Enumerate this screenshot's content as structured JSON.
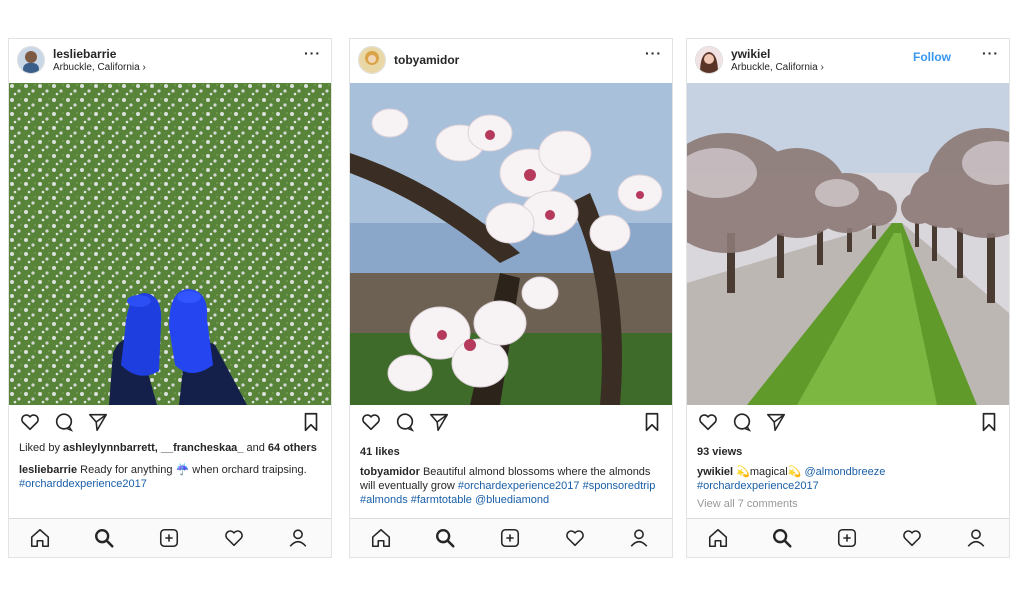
{
  "posts": [
    {
      "username": "lesliebarrie",
      "location": "Arbuckle, California ›",
      "more": "···",
      "likes_prefix": "Liked by",
      "likes_users": "ashleylynnbarrett, __francheskaa_",
      "likes_and": "and",
      "likes_count": "64 others",
      "caption_user": "lesliebarrie",
      "caption_text": "Ready for anything ☔ when orchard traipsing.",
      "caption_tags": "#orcharddexperience2017"
    },
    {
      "username": "tobyamidor",
      "more": "···",
      "likes_line": "41 likes",
      "caption_user": "tobyamidor",
      "caption_text": "Beautiful almond blossoms where the almonds will eventually grow",
      "caption_tags": "#orchardexperience2017 #sponsoredtrip #almonds #farmtotable @bluediamond"
    },
    {
      "username": "ywikiel",
      "location": "Arbuckle, California ›",
      "follow_label": "Follow",
      "more": "···",
      "views_line": "93 views",
      "caption_user": "ywikiel",
      "caption_text": "💫magical💫",
      "caption_mention": "@almondbreeze",
      "caption_tags": "#orchardexperience2017",
      "comments_link": "View all 7 comments"
    }
  ],
  "icons": {
    "actions": [
      "heart-icon",
      "comment-icon",
      "share-icon",
      "bookmark-icon"
    ],
    "nav": [
      "home-icon",
      "search-icon",
      "add-post-icon",
      "activity-heart-icon",
      "profile-icon"
    ]
  },
  "colors": {
    "link": "#1a5fa8",
    "follow": "#3897f0",
    "text": "#262626"
  }
}
